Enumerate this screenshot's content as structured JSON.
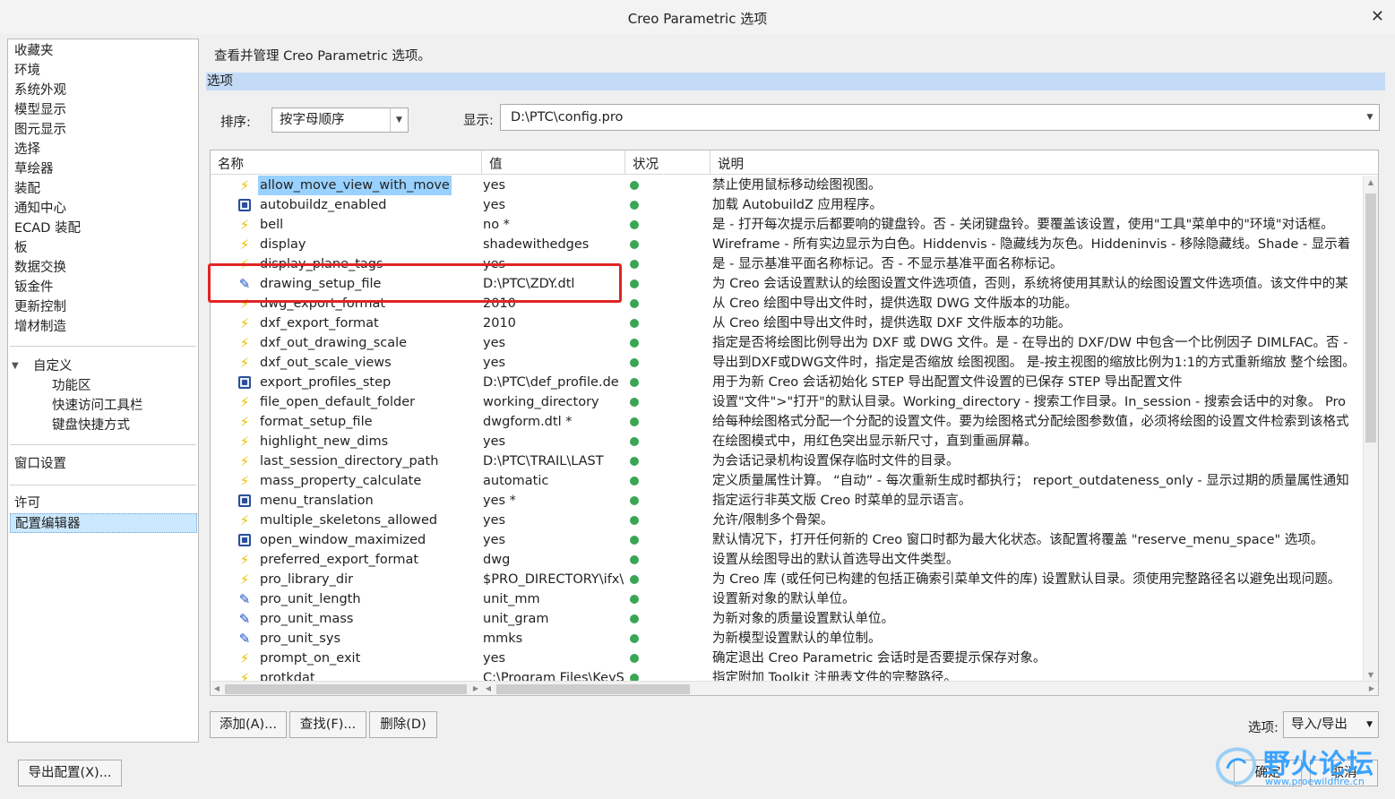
{
  "window": {
    "title": "Creo Parametric 选项",
    "close_icon": "close-icon"
  },
  "sidebar": {
    "items": [
      "收藏夹",
      "环境",
      "系统外观",
      "模型显示",
      "图元显示",
      "选择",
      "草绘器",
      "装配",
      "通知中心",
      "ECAD 装配",
      "板",
      "数据交换",
      "钣金件",
      "更新控制",
      "增材制造"
    ],
    "custom_group": "自定义",
    "custom_items": [
      "功能区",
      "快速访问工具栏",
      "键盘快捷方式"
    ],
    "window_settings": "窗口设置",
    "license": "许可",
    "config_editor": "配置编辑器"
  },
  "main": {
    "description": "查看并管理 Creo Parametric 选项。",
    "section_title": "选项",
    "sort_label": "排序:",
    "sort_value": "按字母顺序",
    "display_label": "显示:",
    "display_value": "D:\\PTC\\config.pro"
  },
  "table": {
    "headers": [
      "名称",
      "值",
      "状况",
      "说明"
    ],
    "rows": [
      {
        "icon": "bolt",
        "name": "allow_move_view_with_move",
        "value": "yes",
        "desc": "禁止使用鼠标移动绘图视图。"
      },
      {
        "icon": "gear",
        "name": "autobuildz_enabled",
        "value": "yes",
        "desc": "加载 AutobuildZ 应用程序。"
      },
      {
        "icon": "bolt",
        "name": "bell",
        "value": "no *",
        "desc": "是 - 打开每次提示后都要响的键盘铃。否 - 关闭键盘铃。要覆盖该设置，使用\"工具\"菜单中的\"环境\"对话框。"
      },
      {
        "icon": "bolt",
        "name": "display",
        "value": "shadewithedges",
        "desc": "Wireframe - 所有实边显示为白色。Hiddenvis - 隐藏线为灰色。Hiddeninvis - 移除隐藏线。Shade - 显示着"
      },
      {
        "icon": "bolt",
        "name": "display_plane_tags",
        "value": "yes",
        "desc": "是 - 显示基准平面名称标记。否 - 不显示基准平面名称标记。"
      },
      {
        "icon": "pen",
        "name": "drawing_setup_file",
        "value": "D:\\PTC\\ZDY.dtl",
        "desc": "为 Creo 会话设置默认的绘图设置文件选项值，否则，系统将使用其默认的绘图设置文件选项值。该文件中的某"
      },
      {
        "icon": "bolt",
        "name": "dwg_export_format",
        "value": "2010",
        "desc": "从 Creo 绘图中导出文件时，提供选取 DWG 文件版本的功能。"
      },
      {
        "icon": "bolt",
        "name": "dxf_export_format",
        "value": "2010",
        "desc": "从 Creo 绘图中导出文件时，提供选取 DXF 文件版本的功能。"
      },
      {
        "icon": "bolt",
        "name": "dxf_out_drawing_scale",
        "value": "yes",
        "desc": "指定是否将绘图比例导出为 DXF 或 DWG 文件。是 - 在导出的 DXF/DW 中包含一个比例因子 DIMLFAC。否 -"
      },
      {
        "icon": "bolt",
        "name": "dxf_out_scale_views",
        "value": "yes",
        "desc": "导出到DXF或DWG文件时，指定是否缩放 绘图视图。 是-按主视图的缩放比例为1:1的方式重新缩放 整个绘图。"
      },
      {
        "icon": "gear",
        "name": "export_profiles_step",
        "value": "D:\\PTC\\def_profile.de",
        "desc": "用于为新 Creo 会话初始化 STEP 导出配置文件设置的已保存 STEP 导出配置文件"
      },
      {
        "icon": "bolt",
        "name": "file_open_default_folder",
        "value": "working_directory",
        "desc": "设置\"文件\">\"打开\"的默认目录。Working_directory - 搜索工作目录。In_session - 搜索会话中的对象。 Pro"
      },
      {
        "icon": "bolt",
        "name": "format_setup_file",
        "value": "dwgform.dtl *",
        "desc": "给每种绘图格式分配一个分配的设置文件。要为绘图格式分配绘图参数值，必须将绘图的设置文件检索到该格式"
      },
      {
        "icon": "bolt",
        "name": "highlight_new_dims",
        "value": "yes",
        "desc": "在绘图模式中，用红色突出显示新尺寸，直到重画屏幕。"
      },
      {
        "icon": "bolt",
        "name": "last_session_directory_path",
        "value": "D:\\PTC\\TRAIL\\LAST",
        "desc": "为会话记录机构设置保存临时文件的目录。"
      },
      {
        "icon": "bolt",
        "name": "mass_property_calculate",
        "value": "automatic",
        "desc": "定义质量属性计算。 “自动” - 每次重新生成时都执行； report_outdateness_only - 显示过期的质量属性通知"
      },
      {
        "icon": "gear",
        "name": "menu_translation",
        "value": "yes *",
        "desc": "指定运行非英文版 Creo 时菜单的显示语言。"
      },
      {
        "icon": "bolt",
        "name": "multiple_skeletons_allowed",
        "value": "yes",
        "desc": "允许/限制多个骨架。"
      },
      {
        "icon": "gear",
        "name": "open_window_maximized",
        "value": "yes",
        "desc": "默认情况下，打开任何新的 Creo 窗口时都为最大化状态。该配置将覆盖 \"reserve_menu_space\" 选项。"
      },
      {
        "icon": "bolt",
        "name": "preferred_export_format",
        "value": "dwg",
        "desc": "设置从绘图导出的默认首选导出文件类型。"
      },
      {
        "icon": "bolt",
        "name": "pro_library_dir",
        "value": "$PRO_DIRECTORY\\ifx\\",
        "desc": "为 Creo 库 (或任何已构建的包括正确索引菜单文件的库) 设置默认目录。须使用完整路径名以避免出现问题。"
      },
      {
        "icon": "pen",
        "name": "pro_unit_length",
        "value": "unit_mm",
        "desc": "设置新对象的默认单位。"
      },
      {
        "icon": "pen",
        "name": "pro_unit_mass",
        "value": "unit_gram",
        "desc": "为新对象的质量设置默认单位。"
      },
      {
        "icon": "pen",
        "name": "pro_unit_sys",
        "value": "mmks",
        "desc": "为新模型设置默认的单位制。"
      },
      {
        "icon": "bolt",
        "name": "prompt_on_exit",
        "value": "yes",
        "desc": "确定退出 Creo Parametric 会话时是否要提示保存对象。"
      },
      {
        "icon": "bolt",
        "name": "protkdat",
        "value": "C:\\Program Files\\KeyS",
        "desc": "指定附加 Toolkit 注册表文件的完整路径。"
      }
    ],
    "status_color": "#3aa655"
  },
  "buttons": {
    "add": "添加(A)...",
    "find": "查找(F)...",
    "delete": "删除(D)",
    "options_label": "选项:",
    "import_export": "导入/导出",
    "export_config": "导出配置(X)...",
    "ok": "确定",
    "cancel": "取消"
  },
  "watermark": {
    "text": "野火论坛",
    "url": "www.proewildfire.cn"
  }
}
